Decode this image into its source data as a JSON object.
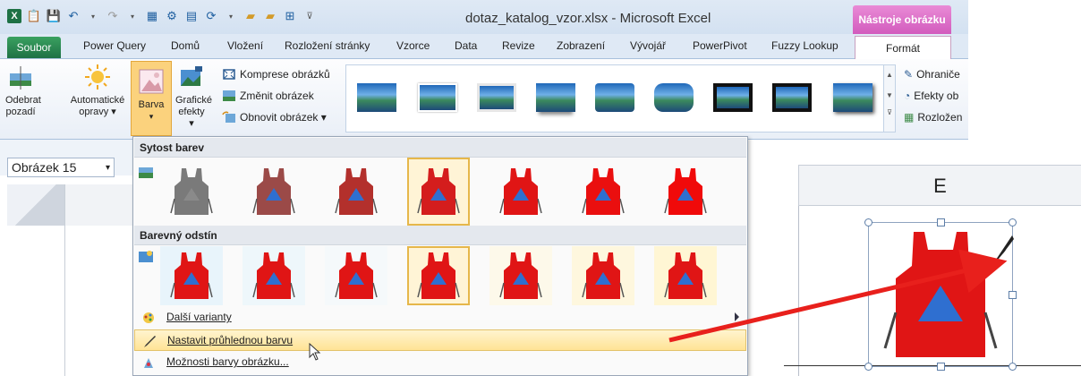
{
  "window": {
    "title": "dotaz_katalog_vzor.xlsx - Microsoft Excel",
    "contextual_title": "Nástroje obrázku"
  },
  "tabs": [
    {
      "label": "Soubor"
    },
    {
      "label": "Power Query"
    },
    {
      "label": "Domů"
    },
    {
      "label": "Vložení"
    },
    {
      "label": "Rozložení stránky"
    },
    {
      "label": "Vzorce"
    },
    {
      "label": "Data"
    },
    {
      "label": "Revize"
    },
    {
      "label": "Zobrazení"
    },
    {
      "label": "Vývojář"
    },
    {
      "label": "PowerPivot"
    },
    {
      "label": "Fuzzy Lookup"
    },
    {
      "label": "Formát"
    }
  ],
  "ribbon": {
    "remove_bg": {
      "line1": "Odebrat",
      "line2": "pozadí"
    },
    "corrections": {
      "line1": "Automatické",
      "line2": "opravy ▾"
    },
    "color": {
      "line1": "Barva",
      "line2": "▾"
    },
    "artistic": {
      "line1": "Grafické",
      "line2": "efekty ▾"
    },
    "compress": "Komprese obrázků",
    "change": "Změnit obrázek",
    "reset": "Obnovit obrázek ▾",
    "border": "Ohraniče",
    "effects": "Efekty ob",
    "layout": "Rozložen"
  },
  "namebox": {
    "value": "Obrázek 15",
    "arrow": "▾"
  },
  "dropdown": {
    "saturation_header": "Sytost barev",
    "tone_header": "Barevný odstín",
    "more": "Další varianty",
    "set_transparent": "Nastavit průhlednou barvu",
    "options": "Možnosti barvy obrázku...",
    "saturation_colors": [
      "#7a7a7a",
      "#9b4a48",
      "#b3302c",
      "#d41d1d",
      "#e01515",
      "#ea0f0f",
      "#f00a0a"
    ],
    "tone_backgrounds": [
      "#e8f4fb",
      "#eef7fb",
      "#f5f9fb",
      "#fbfaf4",
      "#fdf9ea",
      "#fef7de",
      "#fff6d4"
    ],
    "saturation_selected": 3,
    "tone_selected": 3
  },
  "sheet": {
    "column_e": "E"
  },
  "colors": {
    "excel_green": "#1e7145",
    "ribbon_bg": "#dfe9f5",
    "contextual": "#d25bbd",
    "vest_red": "#e01515",
    "vest_blue": "#2f6fd0",
    "highlight": "#ffe395",
    "arrow_red": "#e8201c"
  }
}
